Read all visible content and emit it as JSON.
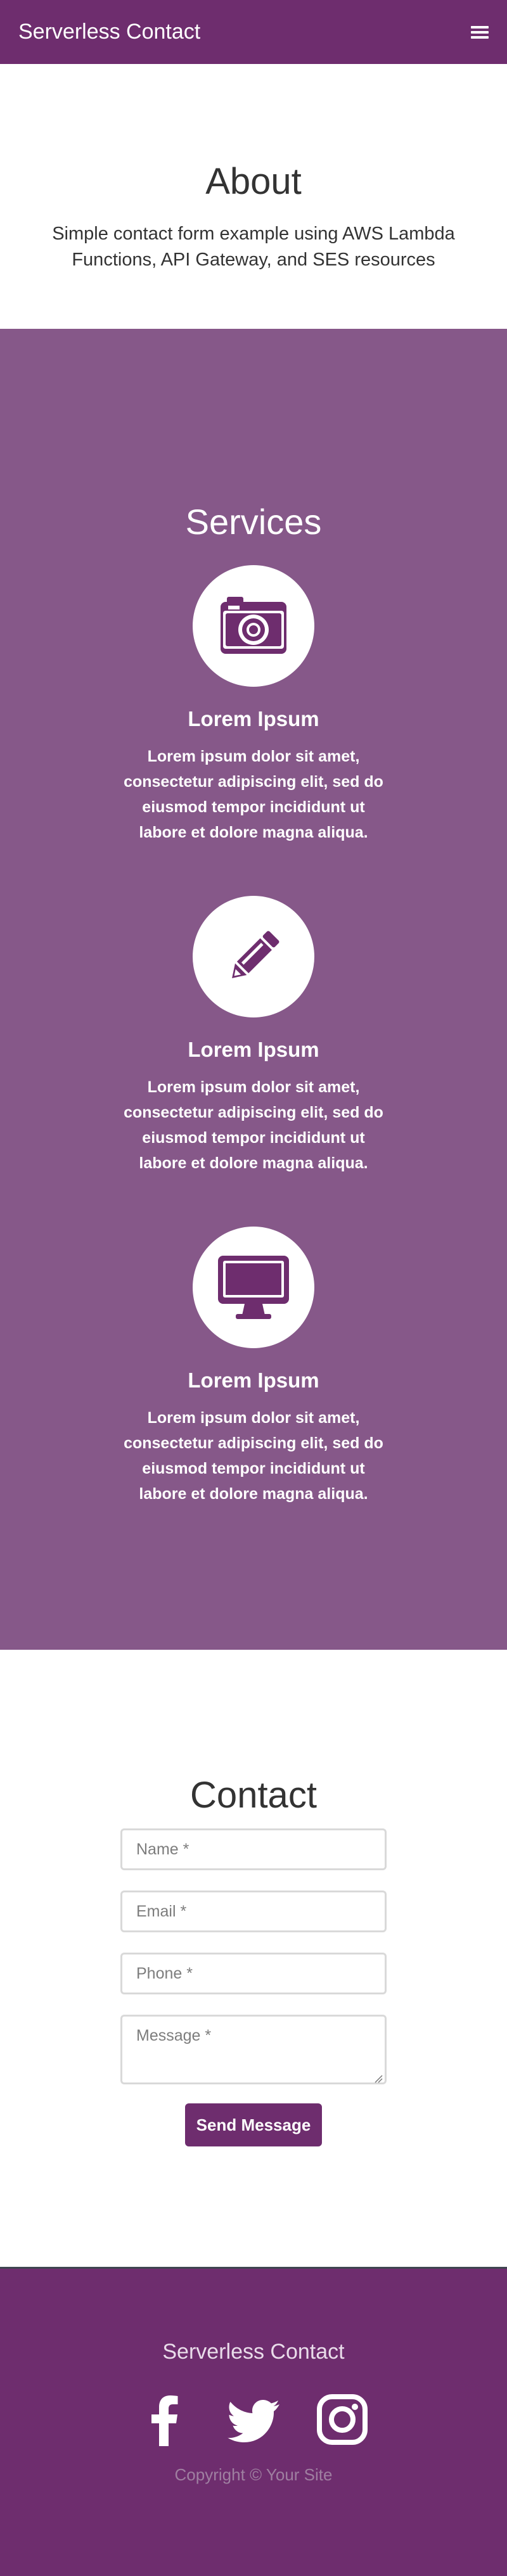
{
  "navbar": {
    "brand": "Serverless Contact",
    "menu_icon": "hamburger-menu-icon"
  },
  "about": {
    "title": "About",
    "text": "Simple contact form example using AWS Lambda Functions, API Gateway, and SES resources"
  },
  "services": {
    "title": "Services",
    "items": [
      {
        "icon": "camera-icon",
        "title": "Lorem Ipsum",
        "text": "Lorem ipsum dolor sit amet, consectetur adipiscing elit, sed do eiusmod tempor incididunt ut labore et dolore magna aliqua."
      },
      {
        "icon": "pencil-icon",
        "title": "Lorem Ipsum",
        "text": "Lorem ipsum dolor sit amet, consectetur adipiscing elit, sed do eiusmod tempor incididunt ut labore et dolore magna aliqua."
      },
      {
        "icon": "desktop-icon",
        "title": "Lorem Ipsum",
        "text": "Lorem ipsum dolor sit amet, consectetur adipiscing elit, sed do eiusmod tempor incididunt ut labore et dolore magna aliqua."
      }
    ]
  },
  "contact": {
    "title": "Contact",
    "name_placeholder": "Name *",
    "email_placeholder": "Email *",
    "phone_placeholder": "Phone *",
    "message_placeholder": "Message *",
    "submit_label": "Send Message"
  },
  "footer": {
    "title": "Serverless Contact",
    "social_icons": [
      "facebook-icon",
      "twitter-icon",
      "instagram-icon"
    ],
    "copyright": "Copyright © Your Site"
  },
  "colors": {
    "navbar_bg": "#6e2d6e",
    "services_bg": "#865889",
    "footer_bg": "#6e2d6e",
    "button_bg": "#6e2d6e"
  }
}
